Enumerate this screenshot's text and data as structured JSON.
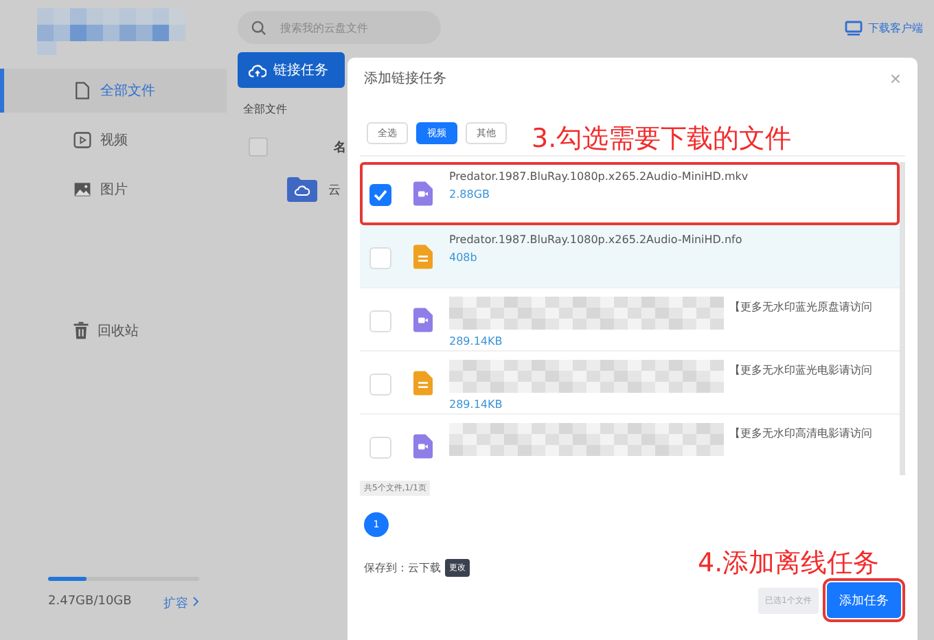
{
  "header": {
    "search": {
      "placeholder": "搜索我的云盘文件"
    },
    "client_link": "下载客户端"
  },
  "sidebar": {
    "items": [
      {
        "label": "全部文件",
        "kind": "file",
        "selected": true
      },
      {
        "label": "视频",
        "kind": "video",
        "selected": false
      },
      {
        "label": "图片",
        "kind": "image",
        "selected": false
      }
    ],
    "recycle": "回收站",
    "storage": {
      "level": 0.25,
      "used": "2.47GB/10GB",
      "expand": "扩容"
    }
  },
  "main": {
    "toolbar_button": "链接任务",
    "breadcrumb": "全部文件",
    "select_all": {
      "checked": false
    },
    "column_1": "名",
    "rows": [
      {
        "name": "云"
      }
    ]
  },
  "dialog": {
    "title": "添加链接任务",
    "close": "×",
    "filters": [
      {
        "label": "全选",
        "selected": false
      },
      {
        "label": "视频",
        "selected": true
      },
      {
        "label": "其他",
        "selected": false
      }
    ],
    "files": [
      {
        "kind": "video",
        "name": "Predator.1987.BluRay.1080p.x265.2Audio-MiniHD.mkv",
        "size": "2.88GB",
        "checked": true,
        "hovered": false,
        "outlined": true,
        "redacted": false
      },
      {
        "kind": "doc",
        "name": "Predator.1987.BluRay.1080p.x265.2Audio-MiniHD.nfo",
        "size": "408b",
        "checked": false,
        "hovered": true,
        "outlined": false,
        "redacted": false
      },
      {
        "kind": "video",
        "name": "【更多无水印蓝光原盘请访问",
        "size": "289.14KB",
        "checked": false,
        "hovered": false,
        "outlined": false,
        "redacted": true
      },
      {
        "kind": "doc",
        "name": "【更多无水印蓝光电影请访问",
        "size": "289.14KB",
        "checked": false,
        "hovered": false,
        "outlined": false,
        "redacted": true
      },
      {
        "kind": "video",
        "name": "【更多无水印高清电影请访问",
        "checked": false,
        "hovered": false,
        "outlined": false,
        "redacted": true
      }
    ],
    "summary": "共5个文件,1/1页",
    "pages": [
      {
        "label": "1",
        "selected": true
      }
    ],
    "save_to": {
      "label": "保存到：云下载",
      "action": "更改"
    },
    "selected_count": "已选1个文件",
    "submit": {
      "label": "添加任务",
      "outlined": true
    }
  },
  "annotations": [
    {
      "text": "3.勾选需要下载的文件"
    },
    {
      "text": "4.添加离线任务"
    }
  ]
}
